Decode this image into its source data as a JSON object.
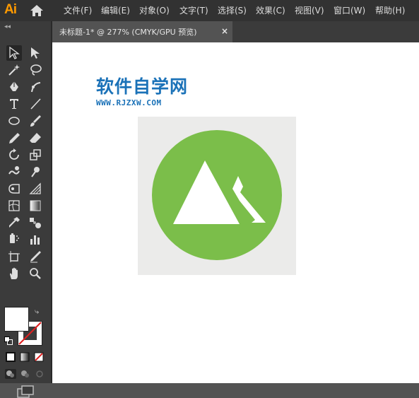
{
  "app": {
    "logo_text": "Ai"
  },
  "menu": [
    {
      "label": "文件(F)"
    },
    {
      "label": "编辑(E)"
    },
    {
      "label": "对象(O)"
    },
    {
      "label": "文字(T)"
    },
    {
      "label": "选择(S)"
    },
    {
      "label": "效果(C)"
    },
    {
      "label": "视图(V)"
    },
    {
      "label": "窗口(W)"
    },
    {
      "label": "帮助(H)"
    }
  ],
  "document_tab": {
    "title": "未标题-1* @ 277% (CMYK/GPU 预览)",
    "close_label": "×"
  },
  "toolbar": {
    "collapse_label": "◂◂",
    "tools": [
      {
        "name": "selection-tool-icon",
        "active": true
      },
      {
        "name": "direct-selection-tool-icon"
      },
      {
        "name": "magic-wand-tool-icon"
      },
      {
        "name": "lasso-tool-icon"
      },
      {
        "name": "pen-tool-icon"
      },
      {
        "name": "curvature-tool-icon"
      },
      {
        "name": "type-tool-icon"
      },
      {
        "name": "line-segment-tool-icon"
      },
      {
        "name": "ellipse-tool-icon"
      },
      {
        "name": "paintbrush-tool-icon"
      },
      {
        "name": "pencil-tool-icon"
      },
      {
        "name": "eraser-tool-icon"
      },
      {
        "name": "rotate-tool-icon"
      },
      {
        "name": "scale-tool-icon"
      },
      {
        "name": "warp-tool-icon"
      },
      {
        "name": "puppet-warp-tool-icon"
      },
      {
        "name": "free-transform-tool-icon"
      },
      {
        "name": "perspective-grid-tool-icon"
      },
      {
        "name": "mesh-tool-icon"
      },
      {
        "name": "gradient-tool-icon"
      },
      {
        "name": "eyedropper-tool-icon"
      },
      {
        "name": "blend-tool-icon"
      },
      {
        "name": "symbol-sprayer-tool-icon"
      },
      {
        "name": "column-graph-tool-icon"
      },
      {
        "name": "artboard-tool-icon"
      },
      {
        "name": "slice-tool-icon"
      },
      {
        "name": "hand-tool-icon"
      },
      {
        "name": "zoom-tool-icon"
      }
    ],
    "fill_color": "#ffffff",
    "stroke_color": "none"
  },
  "canvas": {
    "watermark_title": "软件自学网",
    "watermark_url": "WWW.RJZXW.COM",
    "artboard_bg": "#ebebea",
    "circle_color": "#7bbe4a",
    "shape_color": "#ffffff"
  },
  "colors": {
    "menubar": "#323232",
    "panel": "#3b3b3b",
    "workspace": "#535353",
    "logo": "#ff9a00",
    "watermark": "#1b72b8"
  }
}
